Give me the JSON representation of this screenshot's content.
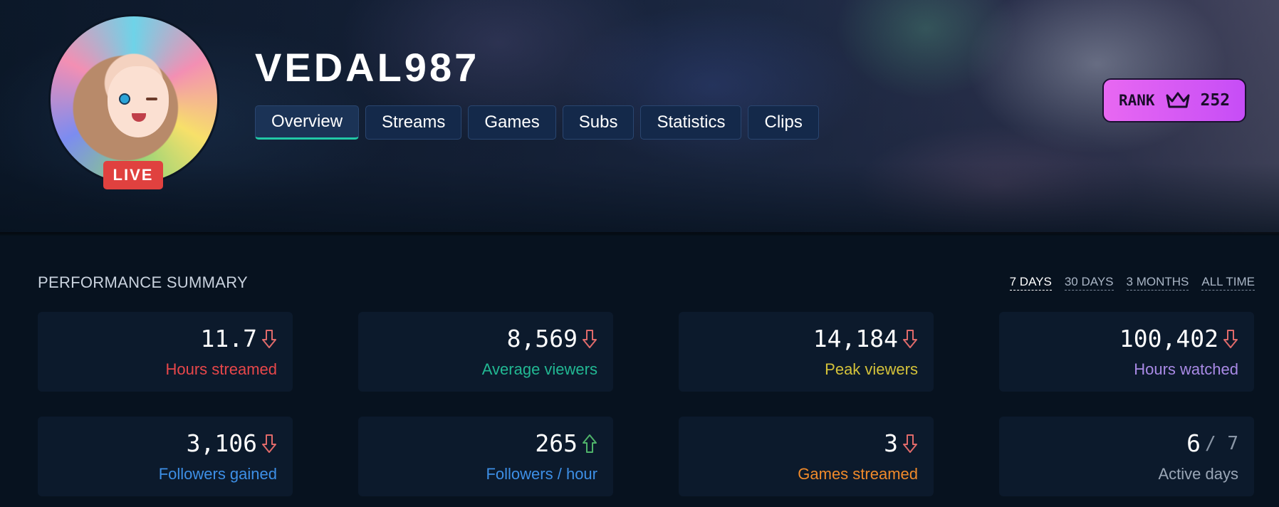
{
  "channel": {
    "name": "VEDAL987",
    "live_label": "LIVE"
  },
  "tabs": [
    {
      "label": "Overview",
      "active": true
    },
    {
      "label": "Streams",
      "active": false
    },
    {
      "label": "Games",
      "active": false
    },
    {
      "label": "Subs",
      "active": false
    },
    {
      "label": "Statistics",
      "active": false
    },
    {
      "label": "Clips",
      "active": false
    }
  ],
  "rank": {
    "label": "RANK",
    "icon": "crown-icon",
    "value": "252"
  },
  "summary": {
    "title": "PERFORMANCE SUMMARY",
    "ranges": [
      {
        "label": "7 DAYS",
        "active": true
      },
      {
        "label": "30 DAYS",
        "active": false
      },
      {
        "label": "3 MONTHS",
        "active": false
      },
      {
        "label": "ALL TIME",
        "active": false
      }
    ],
    "stats": [
      {
        "value": "11.7",
        "label": "Hours streamed",
        "trend": "down",
        "color": "#e8474a"
      },
      {
        "value": "8,569",
        "label": "Average viewers",
        "trend": "down",
        "color": "#22b893"
      },
      {
        "value": "14,184",
        "label": "Peak viewers",
        "trend": "down",
        "color": "#d4c23a"
      },
      {
        "value": "100,402",
        "label": "Hours watched",
        "trend": "down",
        "color": "#a98ae6"
      },
      {
        "value": "3,106",
        "label": "Followers gained",
        "trend": "down",
        "color": "#3d8fe6"
      },
      {
        "value": "265",
        "label": "Followers / hour",
        "trend": "up",
        "color": "#3d8fe6"
      },
      {
        "value": "3",
        "label": "Games streamed",
        "trend": "down",
        "color": "#f08a2a"
      },
      {
        "value": "6",
        "value_suffix": "/ 7",
        "label": "Active days",
        "trend": "none",
        "color": "#9aa6b6"
      }
    ]
  },
  "colors": {
    "trend_down": "#e06a6a",
    "trend_up": "#4fb36a",
    "tab_active_underline": "#21c7a6",
    "live_badge": "#e0413f",
    "rank_gradient_start": "#e868f2",
    "rank_gradient_end": "#c64df6"
  }
}
